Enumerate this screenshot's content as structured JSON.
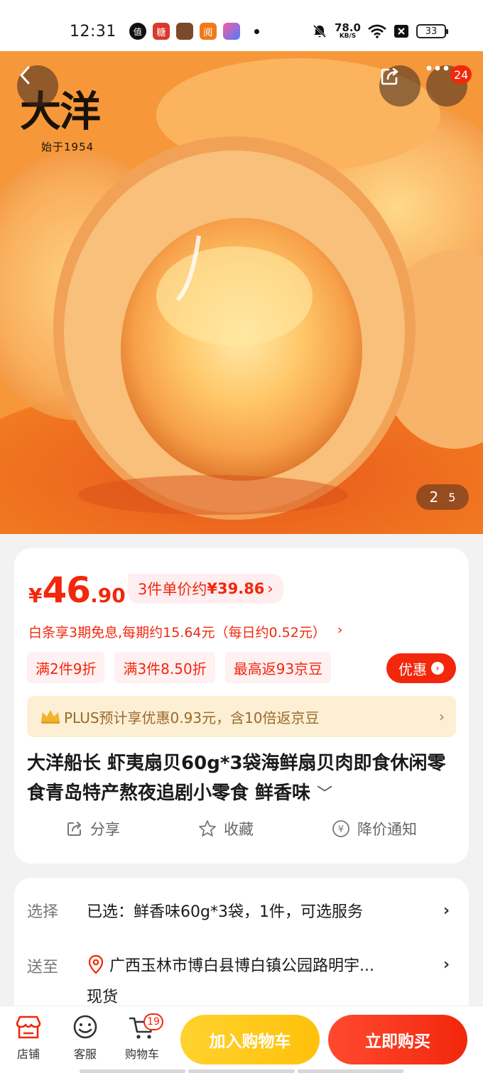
{
  "status_bar": {
    "time": "12:31",
    "notification_icons": [
      "值",
      "糖",
      "",
      "阅",
      ""
    ],
    "net_speed": "78.0",
    "net_unit": "KB/S",
    "battery": "33"
  },
  "hero": {
    "brand_name": "大洋",
    "brand_since": "始于1954",
    "image_index": "2",
    "image_total": "5",
    "more_badge": "24"
  },
  "price": {
    "currency": "¥",
    "integer": "46",
    "decimal": ".90",
    "unit_prefix": "3件单价约",
    "unit_price": "¥39.86",
    "unit_arrow": "›",
    "installment": "白条享3期免息,每期约15.64元（每日约0.52元）",
    "installment_arrow": "›",
    "promo_tags": [
      "满2件9折",
      "满3件8.50折",
      "最高返93京豆"
    ],
    "coupon_label": "优惠",
    "plus_text": "PLUS预计享优惠0.93元，含10倍返京豆",
    "plus_arrow": "›"
  },
  "product": {
    "title": "大洋船长 虾夷扇贝60g*3袋海鲜扇贝肉即食休闲零食青岛特产熬夜追剧小零食 鲜香味",
    "title_expand": "﹀",
    "actions": {
      "share": "分享",
      "favorite": "收藏",
      "price_alert": "降价通知"
    }
  },
  "selection": {
    "select_label": "选择",
    "select_value": "已选：鲜香味60g*3袋，1件，可选服务",
    "delivery_label": "送至",
    "address": "广西玉林市博白县博白镇公园路明宇...",
    "stock": "现货",
    "arrow": "›"
  },
  "bottom_bar": {
    "store_label": "店铺",
    "service_label": "客服",
    "cart_label": "购物车",
    "cart_badge": "19",
    "add_to_cart": "加入购物车",
    "buy_now": "立即购买"
  },
  "colors": {
    "accent_red": "#f2270c",
    "add_cart_yellow": "#ffc10a",
    "plus_gold": "#9a6a2c"
  },
  "icons": [
    "back-arrow-icon",
    "share-icon",
    "more-dots-icon",
    "crown-icon",
    "share-outline-icon",
    "star-icon",
    "price-tag-icon",
    "location-pin-icon",
    "store-icon",
    "smile-service-icon",
    "cart-icon"
  ]
}
